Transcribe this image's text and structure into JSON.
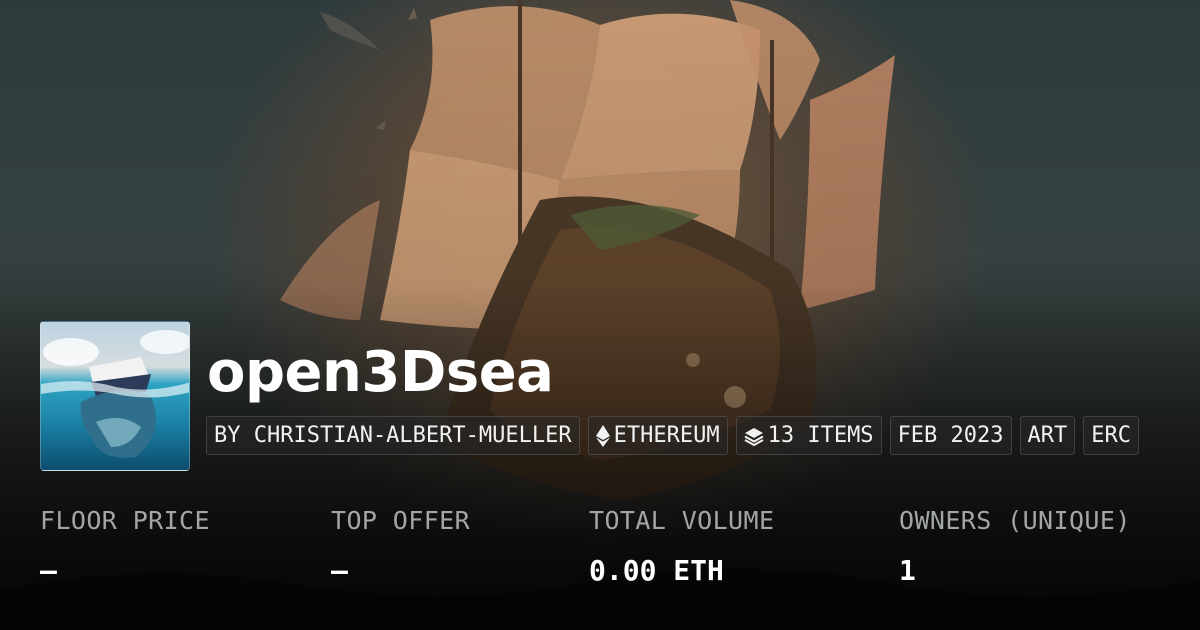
{
  "collection": {
    "name": "open3Dsea"
  },
  "chips": [
    {
      "icon": "",
      "label": "BY CHRISTIAN-ALBERT-MUELLER"
    },
    {
      "icon": "ethereum-icon",
      "label": "ETHEREUM"
    },
    {
      "icon": "layers-icon",
      "label": "13 ITEMS"
    },
    {
      "icon": "",
      "label": "FEB 2023"
    },
    {
      "icon": "",
      "label": "ART"
    },
    {
      "icon": "",
      "label": "ERC"
    }
  ],
  "stats": {
    "floor_price": {
      "label": "FLOOR PRICE",
      "value": "–"
    },
    "top_offer": {
      "label": "TOP OFFER",
      "value": "–"
    },
    "total_volume": {
      "label": "TOTAL VOLUME",
      "value": "0.00 ETH"
    },
    "owners": {
      "label": "OWNERS (UNIQUE)",
      "value": "1"
    }
  },
  "colors": {
    "text_primary": "#ffffff",
    "text_secondary": "#a2a6a8",
    "sail": "#d9a57a",
    "sea_avatar": "#1b7fa4"
  }
}
